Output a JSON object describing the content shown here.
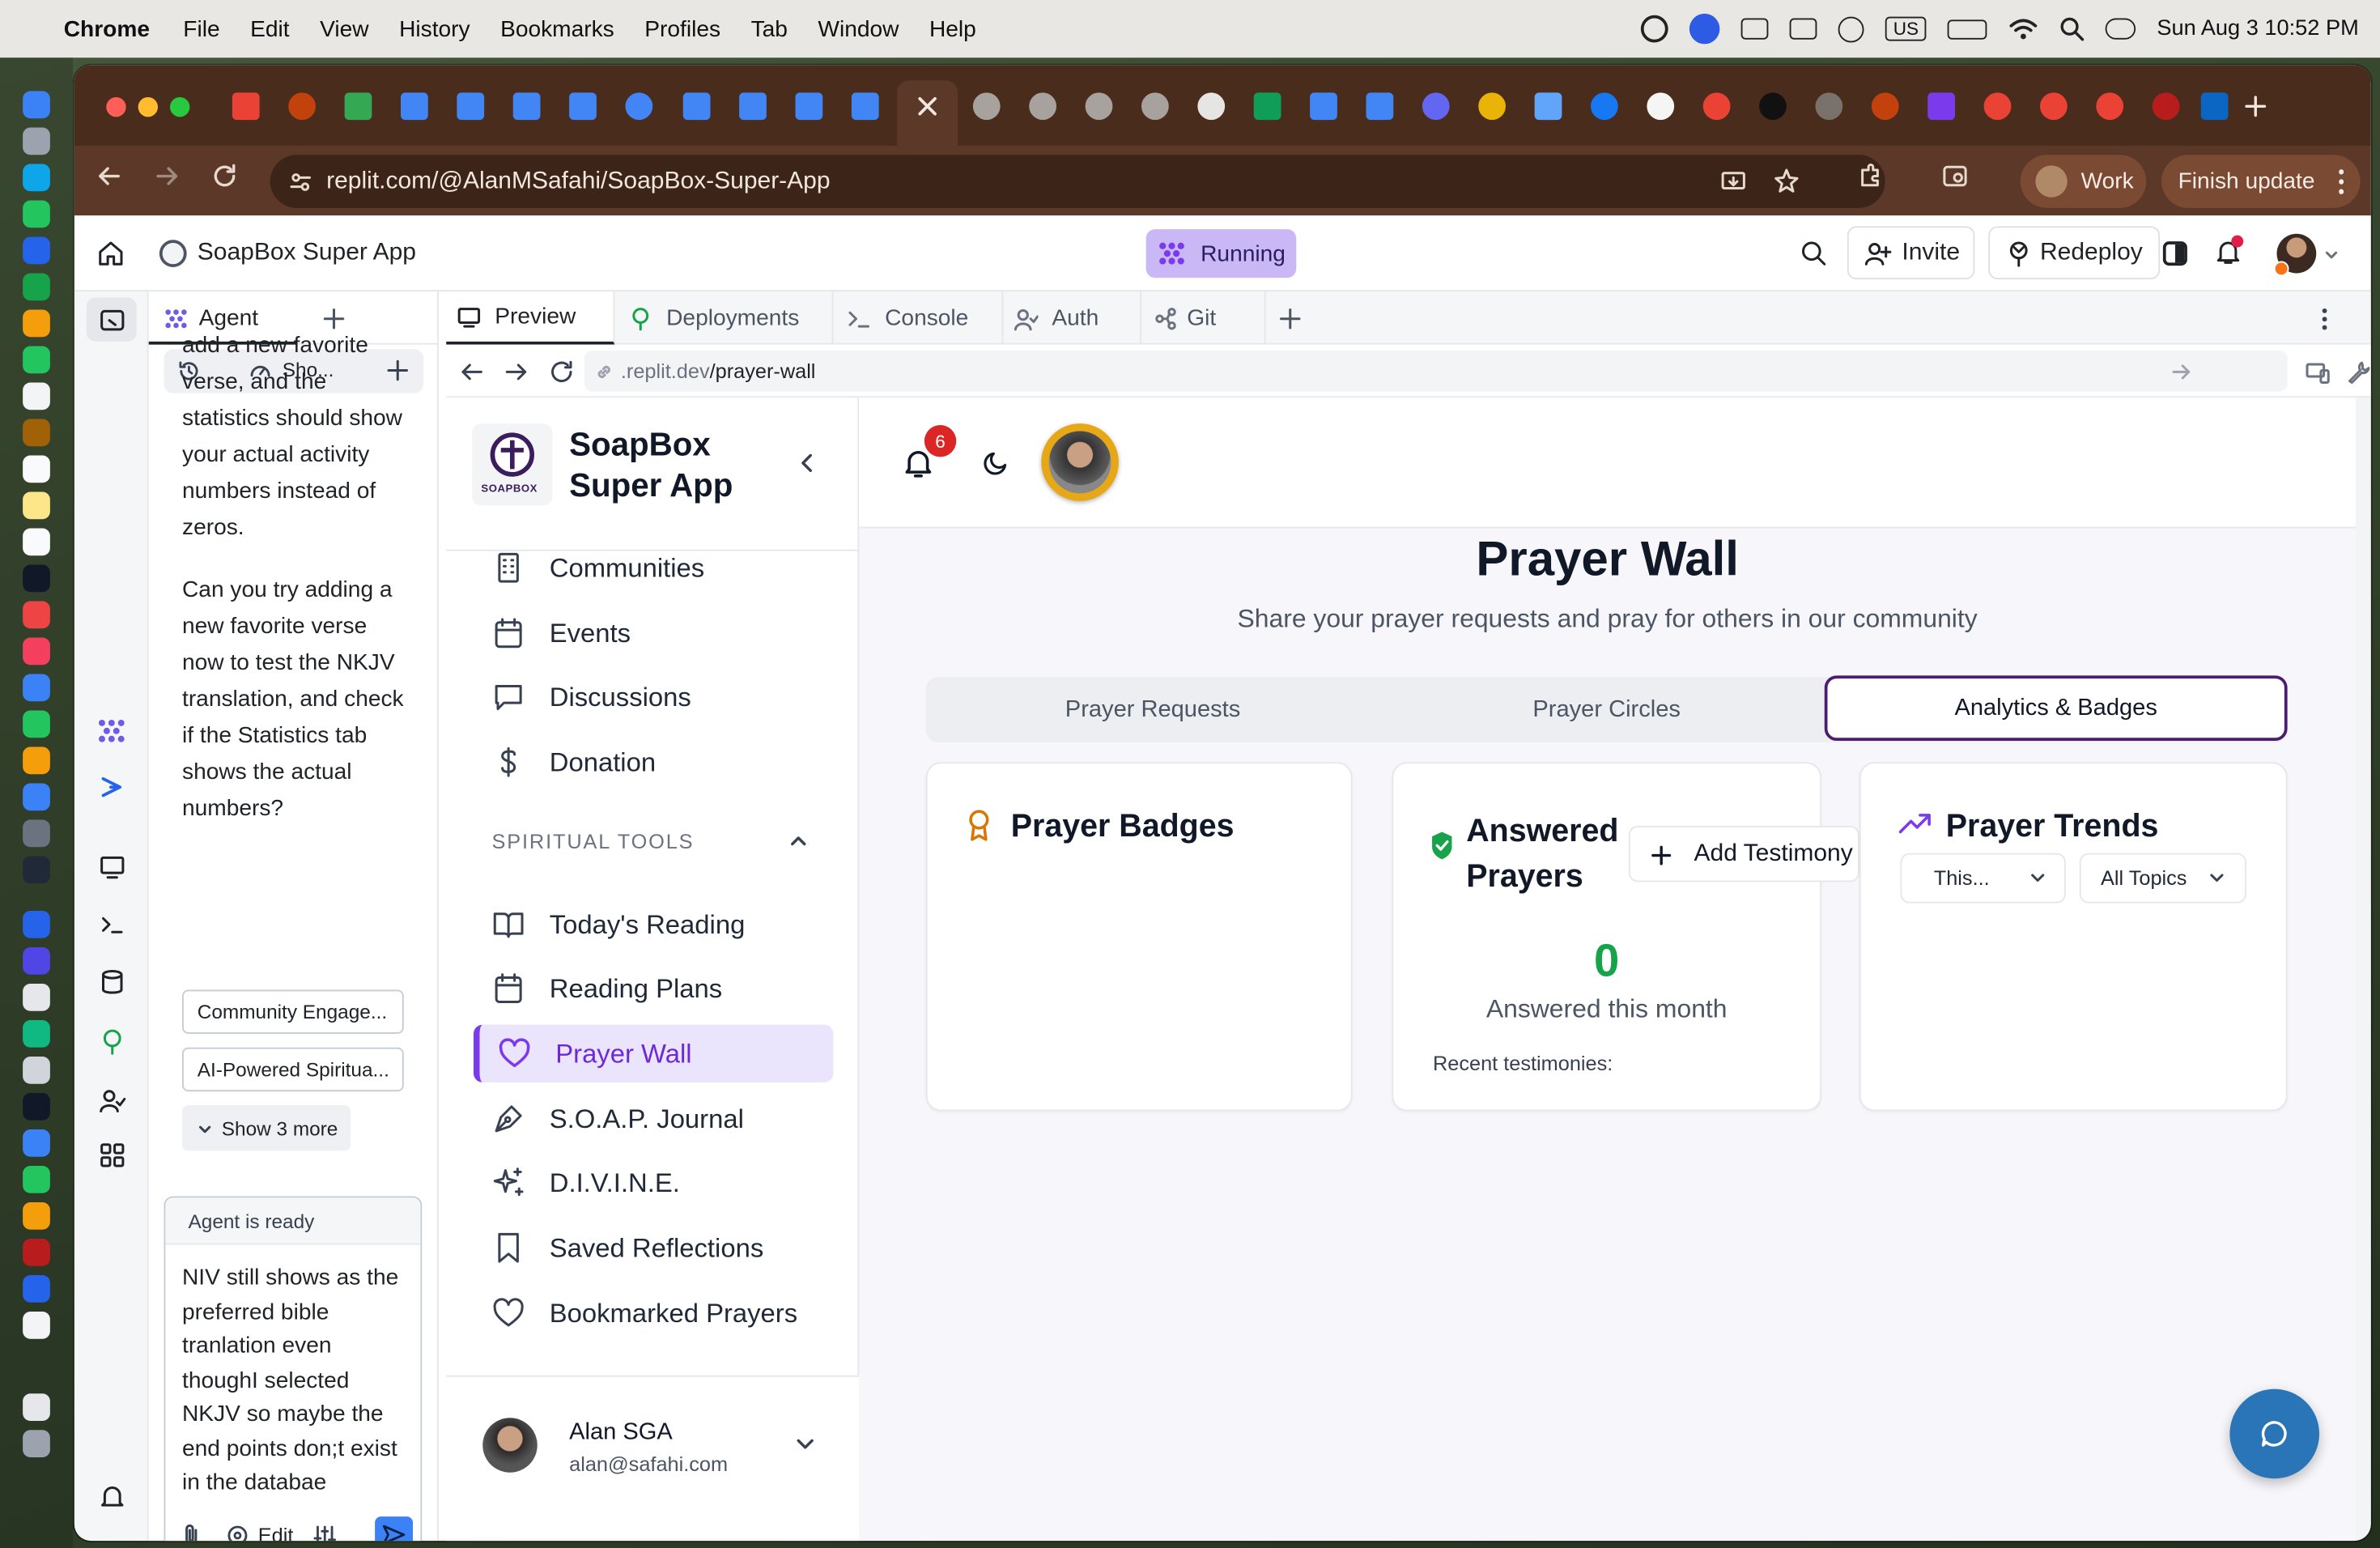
{
  "menubar": {
    "app": "Chrome",
    "items": [
      "File",
      "Edit",
      "View",
      "History",
      "Bookmarks",
      "Profiles",
      "Tab",
      "Window",
      "Help"
    ],
    "input_source": "US",
    "datetime": "Sun Aug 3  10:52 PM"
  },
  "browser": {
    "url": "replit.com/@AlanMSafahi/SoapBox-Super-App",
    "profile": "Work",
    "update": "Finish update"
  },
  "replit": {
    "project": "SoapBox Super App",
    "status": "Running",
    "invite": "Invite",
    "redeploy": "Redeploy",
    "agent_tab": "Agent",
    "history_label": "Sho...",
    "chat_text_1": "add a new favorite verse, and the statistics should show your actual activity numbers instead of zeros.",
    "chat_text_2": "Can you try adding a new favorite verse now to test the NKJV translation, and check if the Statistics tab shows the actual numbers?",
    "suggestions": [
      "Community Engage...",
      "AI-Powered Spiritua..."
    ],
    "show_more": "Show 3 more",
    "agent_status": "Agent is ready",
    "input_value": "NIV still shows as the preferred bible tranlation even thoughI selected NKJV so maybe the end points don;t exist in the databae",
    "edit_label": "Edit",
    "workspace_tabs": [
      "Preview",
      "Deployments",
      "Console",
      "Auth",
      "Git"
    ],
    "preview_url_prefix": ".replit.dev",
    "preview_url_path": "/prayer-wall"
  },
  "app": {
    "name_line1": "SoapBox",
    "name_line2": "Super App",
    "logo_text": "SOAPBOX",
    "nav_top": [
      "Communities",
      "Events",
      "Discussions",
      "Donation"
    ],
    "section_label": "SPIRITUAL TOOLS",
    "nav_tools": [
      "Today's Reading",
      "Reading Plans",
      "Prayer Wall",
      "S.O.A.P. Journal",
      "D.I.V.I.N.E.",
      "Saved Reflections",
      "Bookmarked Prayers"
    ],
    "active_nav": "Prayer Wall",
    "notification_count": "6",
    "user_name": "Alan SGA",
    "user_email": "alan@safahi.com",
    "page_title": "Prayer Wall",
    "page_subtitle": "Share your prayer requests and pray for others in our community",
    "tabs": [
      "Prayer Requests",
      "Prayer Circles",
      "Analytics & Badges"
    ],
    "active_tab": "Analytics & Badges",
    "badges_title": "Prayer Badges",
    "answered_title": "Answered Prayers",
    "add_testimony": "Add Testimony",
    "answered_count": "0",
    "answered_caption": "Answered this month",
    "recent_testimonies": "Recent testimonies:",
    "trends_title": "Prayer Trends",
    "trend_period": "This...",
    "trend_topics": "All Topics",
    "accent_color": "#7c3aed",
    "success_color": "#16a34a"
  }
}
